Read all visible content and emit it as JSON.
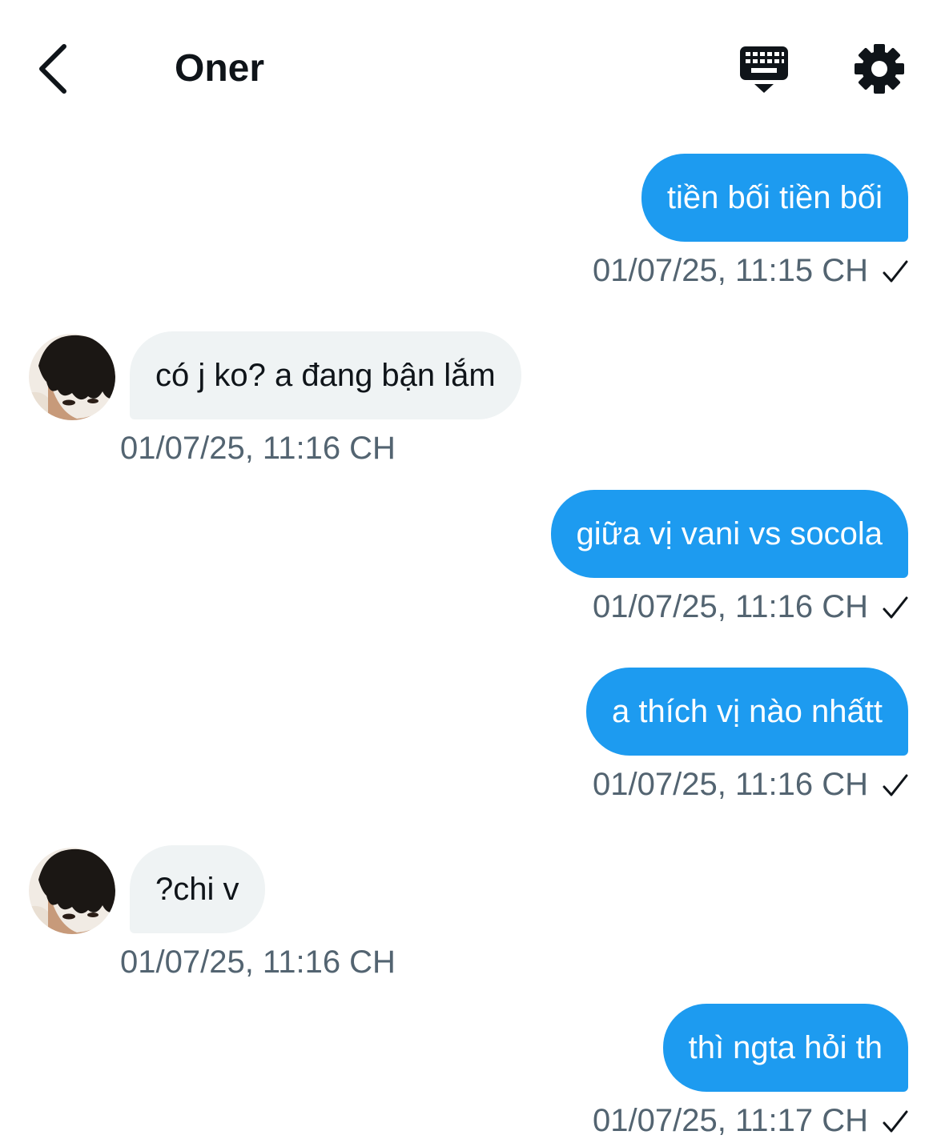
{
  "header": {
    "title": "Oner",
    "back_icon": "chevron-left-icon",
    "keyboard_icon": "keyboard-icon",
    "settings_icon": "gear-icon"
  },
  "colors": {
    "outgoing_bubble": "#1d9bf0",
    "incoming_bubble": "#eff3f4",
    "timestamp": "#536471"
  },
  "messages": [
    {
      "direction": "out",
      "text": "tiền bối tiền bối",
      "time": "01/07/25, 11:15 CH"
    },
    {
      "direction": "in",
      "text": "có j ko? a đang bận lắm",
      "time": "01/07/25, 11:16 CH"
    },
    {
      "direction": "out",
      "text": "giữa vị vani vs socola",
      "time": "01/07/25, 11:16 CH"
    },
    {
      "direction": "out",
      "text": "a thích vị nào nhấtt",
      "time": "01/07/25, 11:16 CH"
    },
    {
      "direction": "in",
      "text": "?chi v",
      "time": "01/07/25, 11:16 CH"
    },
    {
      "direction": "out",
      "text": "thì ngta hỏi th",
      "time": "01/07/25, 11:17 CH"
    }
  ]
}
